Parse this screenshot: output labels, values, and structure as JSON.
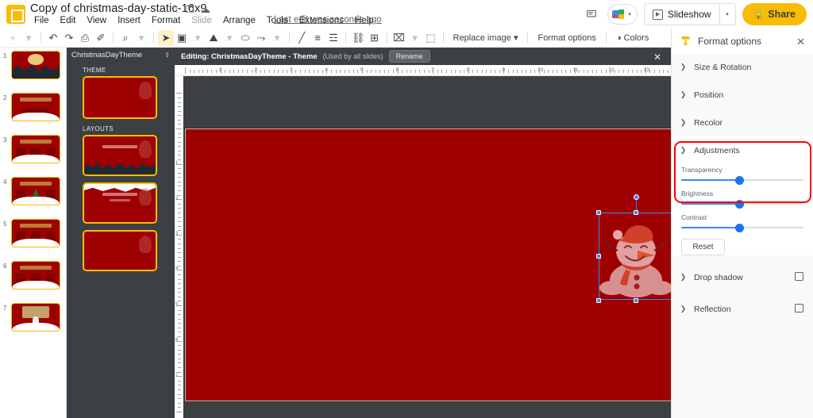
{
  "app": {
    "document_title": "Copy of christmas-day-static-16x9",
    "logo_name": "google-slides-logo"
  },
  "title_actions": [
    {
      "name": "star-icon",
      "glyph": "☆"
    },
    {
      "name": "move-to-folder-icon",
      "glyph": "❐"
    },
    {
      "name": "cloud-saved-icon",
      "glyph": "☁"
    }
  ],
  "menubar": {
    "items": [
      {
        "label": "File",
        "dim": false
      },
      {
        "label": "Edit",
        "dim": false
      },
      {
        "label": "View",
        "dim": false
      },
      {
        "label": "Insert",
        "dim": false
      },
      {
        "label": "Format",
        "dim": false
      },
      {
        "label": "Slide",
        "dim": true
      },
      {
        "label": "Arrange",
        "dim": false
      },
      {
        "label": "Tools",
        "dim": false
      },
      {
        "label": "Extensions",
        "dim": false
      },
      {
        "label": "Help",
        "dim": false
      }
    ],
    "last_edit": "Last edit was seconds ago"
  },
  "topbar_right": {
    "comment_icon": "comment-icon",
    "meet_label": "meet-camera-icon",
    "slideshow_label": "Slideshow",
    "share_label": "Share",
    "share_lock_glyph": "🔒"
  },
  "toolbar": {
    "groups": [
      {
        "items": [
          {
            "name": "new-slide-button",
            "glyph": "+",
            "muted": true,
            "active": false
          },
          {
            "name": "new-slide-dropdown-icon",
            "glyph": "▾",
            "muted": true,
            "active": false
          }
        ]
      },
      {
        "items": [
          {
            "name": "undo-button",
            "glyph": "↶",
            "muted": false,
            "active": false
          },
          {
            "name": "redo-button",
            "glyph": "↷",
            "muted": false,
            "active": false
          },
          {
            "name": "print-button",
            "glyph": "⎙",
            "muted": false,
            "active": false
          },
          {
            "name": "paint-format-button",
            "glyph": "✐",
            "muted": false,
            "active": false
          }
        ]
      },
      {
        "items": [
          {
            "name": "zoom-button",
            "glyph": "⌕",
            "muted": false,
            "active": false
          },
          {
            "name": "zoom-dropdown-icon",
            "glyph": "▾",
            "muted": true,
            "active": false
          }
        ]
      },
      {
        "items": [
          {
            "name": "select-tool-button",
            "glyph": "➤",
            "muted": false,
            "active": true
          },
          {
            "name": "text-box-button",
            "glyph": "▣",
            "muted": false,
            "active": false
          },
          {
            "name": "text-box-dropdown-icon",
            "glyph": "▾",
            "muted": true,
            "active": false
          },
          {
            "name": "insert-image-button",
            "glyph": "⛰",
            "muted": false,
            "active": false
          },
          {
            "name": "insert-image-dropdown-icon",
            "glyph": "▾",
            "muted": true,
            "active": false
          },
          {
            "name": "shape-button",
            "glyph": "⬭",
            "muted": false,
            "active": false
          },
          {
            "name": "line-button",
            "glyph": "⤳",
            "muted": false,
            "active": false
          },
          {
            "name": "line-dropdown-icon",
            "glyph": "▾",
            "muted": true,
            "active": false
          }
        ]
      },
      {
        "items": [
          {
            "name": "pen-button",
            "glyph": "╱",
            "muted": false,
            "active": false
          },
          {
            "name": "align-button",
            "glyph": "≡",
            "muted": false,
            "active": false
          },
          {
            "name": "line-spacing-button",
            "glyph": "☲",
            "muted": false,
            "active": false
          }
        ]
      },
      {
        "items": [
          {
            "name": "insert-link-button",
            "glyph": "⛓",
            "muted": false,
            "active": false
          },
          {
            "name": "insert-comment-button",
            "glyph": "⊞",
            "muted": false,
            "active": false
          }
        ]
      },
      {
        "items": [
          {
            "name": "crop-image-button",
            "glyph": "⌧",
            "muted": false,
            "active": false
          },
          {
            "name": "crop-dropdown-icon",
            "glyph": "▾",
            "muted": true,
            "active": false
          },
          {
            "name": "mask-image-button",
            "glyph": "⬚",
            "muted": false,
            "active": false
          }
        ]
      }
    ],
    "text_buttons": [
      {
        "name": "replace-image-button",
        "label": "Replace image ▾"
      },
      {
        "name": "format-options-button",
        "label": "Format options"
      },
      {
        "name": "colors-button",
        "label": "◑ Colors"
      }
    ],
    "collapse_glyph": "⌃"
  },
  "filmstrip": {
    "slides": [
      {
        "number": "1",
        "kind": "title"
      },
      {
        "number": "2",
        "kind": "section"
      },
      {
        "number": "3",
        "kind": "three-card"
      },
      {
        "number": "4",
        "kind": "tree"
      },
      {
        "number": "5",
        "kind": "three-card"
      },
      {
        "number": "6",
        "kind": "three-card"
      },
      {
        "number": "7",
        "kind": "santa"
      }
    ]
  },
  "theme_panel": {
    "header_title": "ChristmasDayTheme",
    "resize_glyph": "⇕",
    "theme_label": "THEME",
    "layouts_label": "LAYOUTS",
    "theme_thumb": {
      "name": "theme-master-thumbnail"
    },
    "layouts": [
      {
        "name": "layout-title-slide",
        "style": "trees"
      },
      {
        "name": "layout-section-header",
        "style": "snowtop"
      },
      {
        "name": "layout-blank",
        "style": "plain"
      }
    ]
  },
  "editing_bar": {
    "label": "Editing: ChristmasDayTheme - Theme",
    "sub_label": "(Used by all slides)",
    "rename_label": "Rename",
    "close_glyph": "✕"
  },
  "ruler": {
    "horizontal_ticks": [
      "1",
      "2",
      "3",
      "4",
      "5",
      "6",
      "7",
      "8",
      "9",
      "10",
      "11",
      "12",
      "13"
    ],
    "vertical_ticks": [
      "1",
      "2",
      "3",
      "4",
      "5",
      "6",
      "7"
    ]
  },
  "canvas": {
    "slide_background_color": "#9E0000",
    "selected_object": "snowman-image",
    "selection_color": "#4285F4"
  },
  "format_panel": {
    "title": "Format options",
    "close_glyph": "✕",
    "sections": [
      {
        "name": "size-and-rotation",
        "label": "Size & Rotation",
        "expanded": false,
        "checkbox": false
      },
      {
        "name": "position",
        "label": "Position",
        "expanded": false,
        "checkbox": false
      },
      {
        "name": "recolor",
        "label": "Recolor",
        "expanded": false,
        "checkbox": false
      }
    ],
    "adjustments": {
      "label": "Adjustments",
      "expanded": true,
      "sliders": [
        {
          "name": "transparency-slider",
          "label": "Transparency",
          "percent": 48
        },
        {
          "name": "brightness-slider",
          "label": "Brightness",
          "percent": 48
        },
        {
          "name": "contrast-slider",
          "label": "Contrast",
          "percent": 48
        }
      ],
      "reset_label": "Reset"
    },
    "bottom_sections": [
      {
        "name": "drop-shadow",
        "label": "Drop shadow",
        "checkbox": true
      },
      {
        "name": "reflection",
        "label": "Reflection",
        "checkbox": true
      }
    ],
    "highlight_color": "#FF0000",
    "highlight_target": "adjustments-transparency-group"
  }
}
